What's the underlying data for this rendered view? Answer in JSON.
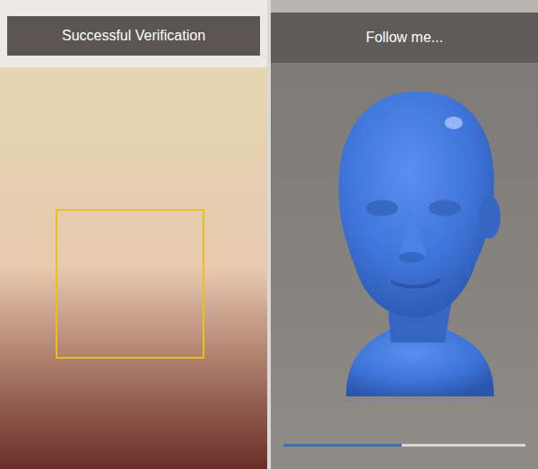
{
  "left_panel": {
    "header": "Successful Verification",
    "face_detected": true
  },
  "right_panel": {
    "header": "Follow me...",
    "progress": {
      "level": 0.49
    }
  }
}
